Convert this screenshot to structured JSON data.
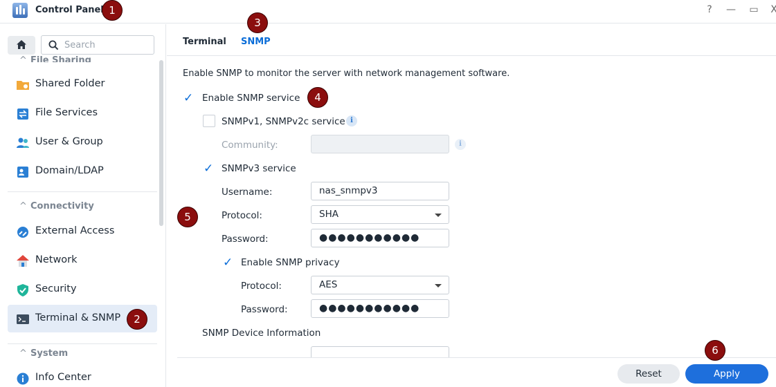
{
  "window": {
    "title": "Control Panel",
    "help": "?",
    "minimize": "—",
    "maximize": "▭",
    "close": "X"
  },
  "badges": [
    "1",
    "2",
    "3",
    "4",
    "5",
    "6"
  ],
  "sidebar": {
    "search_placeholder": "Search",
    "partial_section": "File Sharing",
    "items": [
      {
        "label": "Shared Folder",
        "icon": "shared-folder-icon"
      },
      {
        "label": "File Services",
        "icon": "file-services-icon"
      },
      {
        "label": "User & Group",
        "icon": "user-group-icon"
      },
      {
        "label": "Domain/LDAP",
        "icon": "domain-ldap-icon"
      },
      {
        "label": "External Access",
        "icon": "external-access-icon"
      },
      {
        "label": "Network",
        "icon": "network-icon"
      },
      {
        "label": "Security",
        "icon": "security-icon"
      },
      {
        "label": "Terminal & SNMP",
        "icon": "terminal-icon",
        "active": true
      },
      {
        "label": "Info Center",
        "icon": "info-center-icon"
      }
    ],
    "sections": {
      "connectivity": "Connectivity",
      "system": "System"
    }
  },
  "tabs": {
    "terminal": "Terminal",
    "snmp": "SNMP"
  },
  "snmp": {
    "description": "Enable SNMP to monitor the server with network management software.",
    "enable_label": "Enable SNMP service",
    "enable_checked": true,
    "v1v2_label": "SNMPv1, SNMPv2c service",
    "v1v2_checked": false,
    "community_label": "Community:",
    "community_value": "",
    "v3_label": "SNMPv3 service",
    "v3_checked": true,
    "username_label": "Username:",
    "username_value": "nas_snmpv3",
    "protocol_label": "Protocol:",
    "protocol_value": "SHA",
    "password_label": "Password:",
    "password_value": "●●●●●●●●●●●",
    "privacy_label": "Enable SNMP privacy",
    "privacy_checked": true,
    "privacy_protocol_label": "Protocol:",
    "privacy_protocol_value": "AES",
    "privacy_password_label": "Password:",
    "privacy_password_value": "●●●●●●●●●●●",
    "device_info_label": "SNMP Device Information"
  },
  "footer": {
    "reset": "Reset",
    "apply": "Apply"
  },
  "colors": {
    "accent": "#0a6dd8",
    "apply": "#1e6fdc",
    "badge": "#8b0e0e"
  }
}
